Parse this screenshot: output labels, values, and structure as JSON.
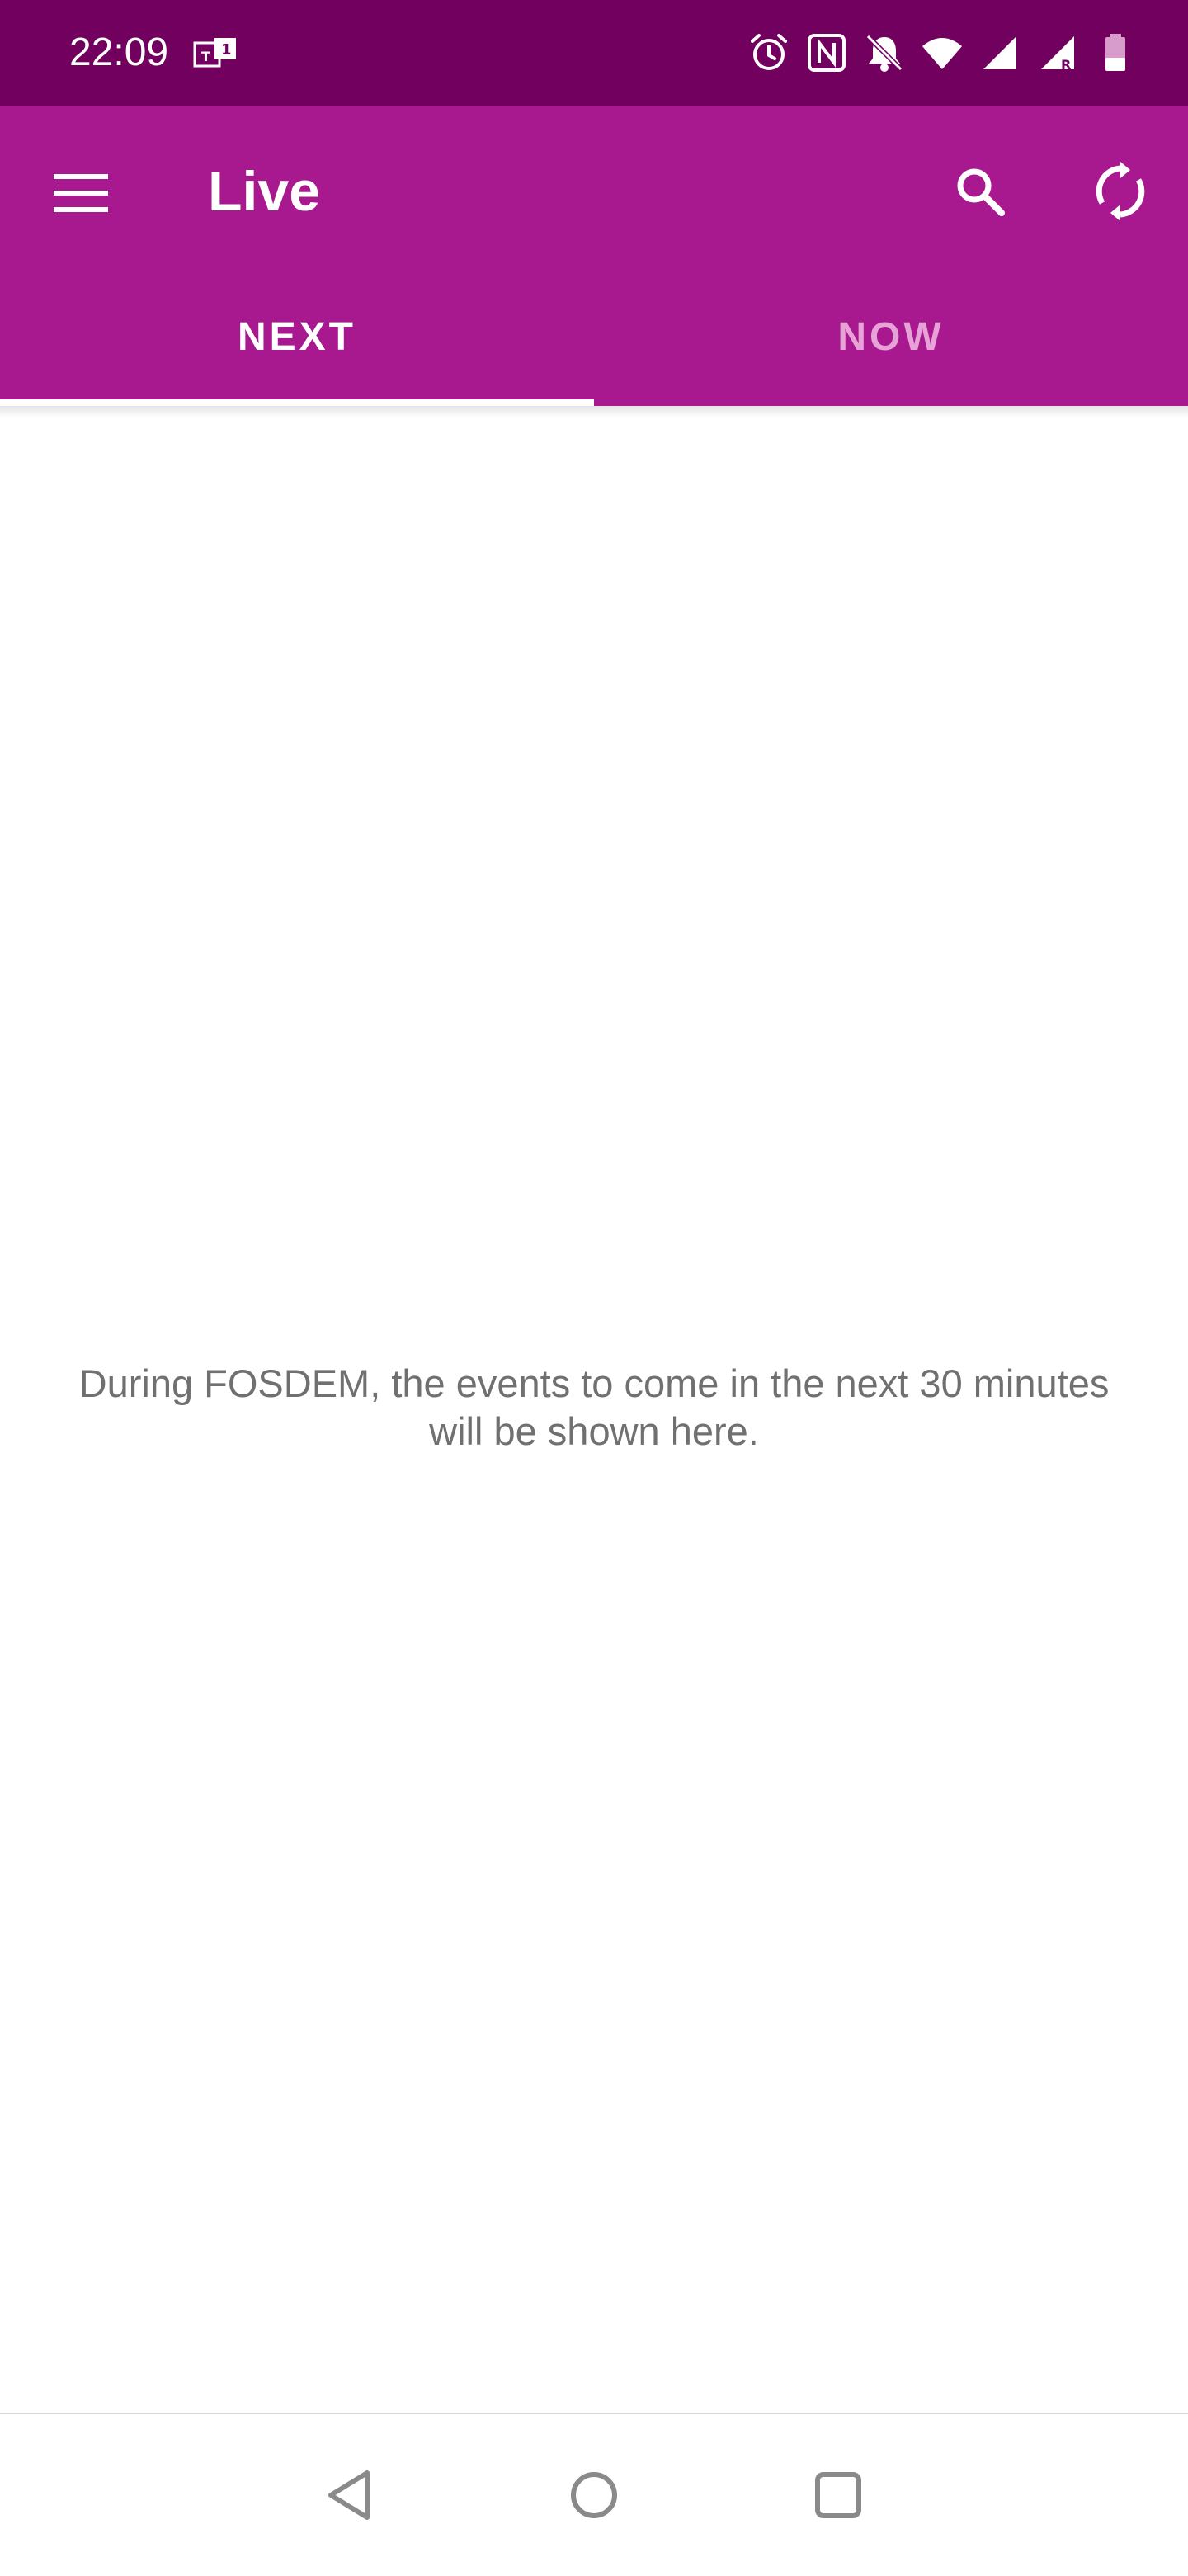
{
  "status_bar": {
    "time": "22:09",
    "left_icon": "teams-notification-icon",
    "icons": [
      "alarm-icon",
      "nfc-icon",
      "bell-off-icon",
      "wifi-icon",
      "signal-icon",
      "signal-roaming-icon",
      "battery-icon"
    ]
  },
  "app_bar": {
    "title": "Live",
    "menu_icon": "menu-icon",
    "actions": [
      "search-icon",
      "refresh-icon"
    ],
    "background": "#a8198f",
    "status_background": "#72005f"
  },
  "tabs": [
    {
      "label": "NEXT",
      "active": true
    },
    {
      "label": "NOW",
      "active": false
    }
  ],
  "content": {
    "empty_message_line1": "During FOSDEM, the events to come in the next 30 minutes",
    "empty_message_line2": "will be shown here."
  },
  "nav_bar": {
    "buttons": [
      "back-icon",
      "home-icon",
      "recents-icon"
    ]
  }
}
